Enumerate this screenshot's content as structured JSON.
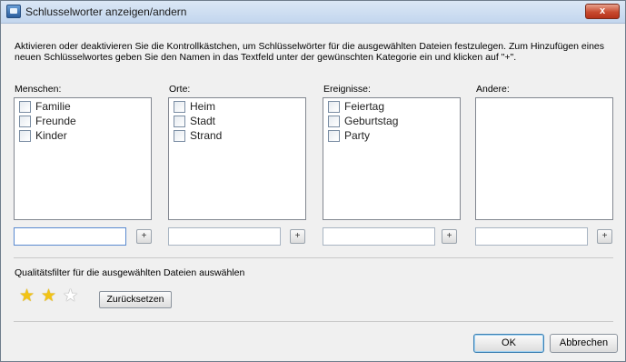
{
  "window": {
    "title": "Schlusselworter anzeigen/andern",
    "close_label": "x"
  },
  "description": "Aktivieren oder deaktivieren Sie die Kontrollkästchen, um Schlüsselwörter für die ausgewählten Dateien festzulegen. Zum Hinzufügen eines neuen Schlüsselwortes geben Sie den Namen in das Textfeld unter der gewünschten Kategorie ein und klicken auf \"+\".",
  "columns": [
    {
      "label": "Menschen:",
      "items": [
        "Familie",
        "Freunde",
        "Kinder"
      ],
      "input_value": "",
      "add_label": "+"
    },
    {
      "label": "Orte:",
      "items": [
        "Heim",
        "Stadt",
        "Strand"
      ],
      "input_value": "",
      "add_label": "+"
    },
    {
      "label": "Ereignisse:",
      "items": [
        "Feiertag",
        "Geburtstag",
        "Party"
      ],
      "input_value": "",
      "add_label": "+"
    },
    {
      "label": "Andere:",
      "items": [],
      "input_value": "",
      "add_label": "+"
    }
  ],
  "quality": {
    "label": "Qualitätsfilter für die ausgewählten Dateien auswählen",
    "rating": 2,
    "max_rating": 3,
    "reset_label": "Zurücksetzen"
  },
  "footer": {
    "ok_label": "OK",
    "cancel_label": "Abbrechen"
  }
}
